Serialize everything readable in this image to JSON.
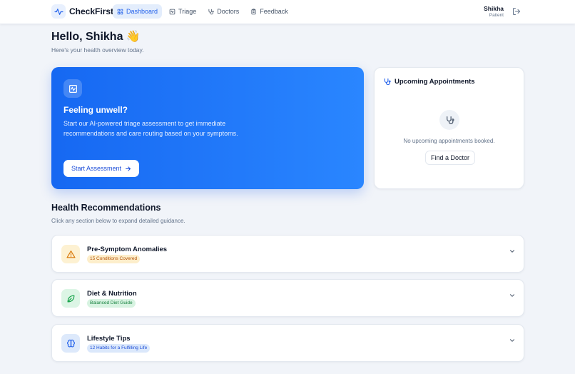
{
  "header": {
    "brand": "CheckFirst",
    "nav": [
      {
        "label": "Dashboard",
        "icon": "dashboard-icon",
        "active": true
      },
      {
        "label": "Triage",
        "icon": "triage-icon",
        "active": false
      },
      {
        "label": "Doctors",
        "icon": "stethoscope-icon",
        "active": false
      },
      {
        "label": "Feedback",
        "icon": "clipboard-icon",
        "active": false
      }
    ],
    "user_name": "Shikha",
    "user_role": "Patient"
  },
  "greeting": {
    "title": "Hello, Shikha 👋",
    "subtitle": "Here's your health overview today."
  },
  "hero": {
    "title": "Feeling unwell?",
    "description": "Start our AI-powered triage assessment to get immediate recommendations and care routing based on your symptoms.",
    "button": "Start Assessment"
  },
  "appointments": {
    "title": "Upcoming Appointments",
    "empty_text": "No upcoming appointments booked.",
    "button": "Find a Doctor"
  },
  "recommendations": {
    "title": "Health Recommendations",
    "subtitle": "Click any section below to expand detailed guidance.",
    "items": [
      {
        "name": "Pre-Symptom Anomalies",
        "badge": "15 Conditions Covered",
        "icon": "warning-icon",
        "accent": "#d97706",
        "bg": "#fdf1d2",
        "badge_bg": "#fdeecb",
        "badge_fg": "#b45309"
      },
      {
        "name": "Diet & Nutrition",
        "badge": "Balanced Diet Guide",
        "icon": "leaf-icon",
        "accent": "#16a34a",
        "bg": "#dcf5e5",
        "badge_bg": "#d7f3e1",
        "badge_fg": "#15803d"
      },
      {
        "name": "Lifestyle Tips",
        "badge": "12 Habits for a Fulfilling Life",
        "icon": "brain-icon",
        "accent": "#2563eb",
        "bg": "#dde9fb",
        "badge_bg": "#dbe8fb",
        "badge_fg": "#1d4ed8"
      }
    ]
  },
  "colors": {
    "primary": "#2563eb",
    "background": "#f1f4f9"
  }
}
